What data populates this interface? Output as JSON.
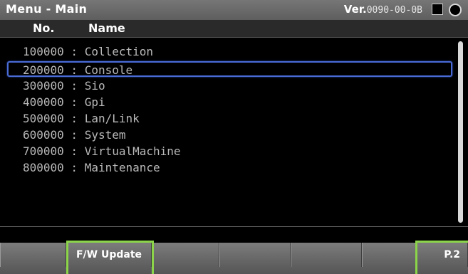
{
  "window": {
    "title": "Menu - Main",
    "version_label": "Ver.",
    "version_value": "0090-00-0B"
  },
  "columns": {
    "no": "No.",
    "name": "Name"
  },
  "menu_items": [
    {
      "code": "100000",
      "sep": " : ",
      "name": "Collection"
    },
    {
      "code": "200000",
      "sep": " : ",
      "name": "Console"
    },
    {
      "code": "300000",
      "sep": " : ",
      "name": "Sio"
    },
    {
      "code": "400000",
      "sep": " : ",
      "name": "Gpi"
    },
    {
      "code": "500000",
      "sep": " : ",
      "name": "Lan/Link"
    },
    {
      "code": "600000",
      "sep": " : ",
      "name": "System"
    },
    {
      "code": "700000",
      "sep": " : ",
      "name": "VirtualMachine"
    },
    {
      "code": "800000",
      "sep": " : ",
      "name": "Maintenance"
    }
  ],
  "selected_item": "200000",
  "function_keys": [
    "",
    "F/W Update",
    "",
    "",
    "",
    "",
    "P.2"
  ],
  "colors": {
    "selection_border": "#4a6bd6",
    "highlight_green": "#8cd44a",
    "text": "#b9b9b9"
  }
}
